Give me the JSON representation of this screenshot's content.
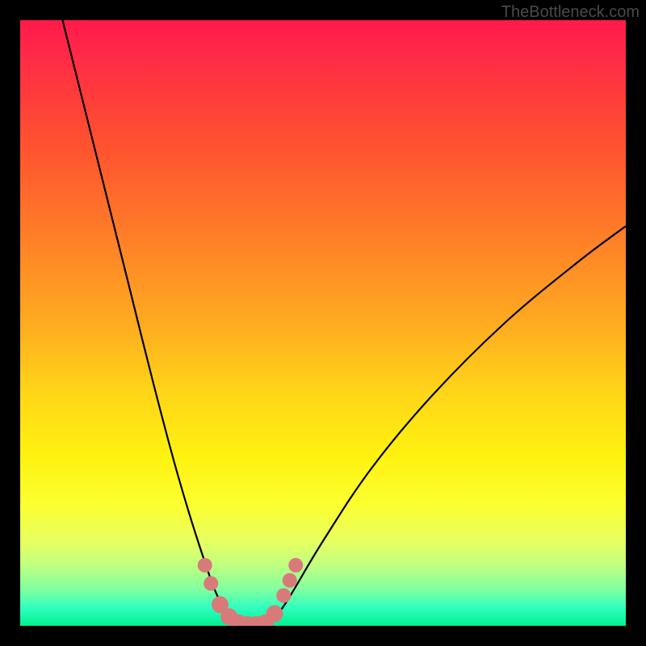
{
  "watermark": "TheBottleneck.com",
  "chart_data": {
    "type": "line",
    "title": "",
    "xlabel": "",
    "ylabel": "",
    "xlim": [
      0,
      100
    ],
    "ylim": [
      0,
      100
    ],
    "background_gradient": {
      "stops": [
        {
          "pos": 0,
          "color": "#ff1a4a"
        },
        {
          "pos": 20,
          "color": "#ff5030"
        },
        {
          "pos": 50,
          "color": "#ffab20"
        },
        {
          "pos": 72,
          "color": "#fff210"
        },
        {
          "pos": 90,
          "color": "#c0ff80"
        },
        {
          "pos": 100,
          "color": "#00f090"
        }
      ]
    },
    "series": [
      {
        "name": "left-curve",
        "color": "#000000",
        "points": [
          {
            "x": 7,
            "y": 100
          },
          {
            "x": 10,
            "y": 88
          },
          {
            "x": 14,
            "y": 72
          },
          {
            "x": 18,
            "y": 56
          },
          {
            "x": 22,
            "y": 40
          },
          {
            "x": 26,
            "y": 25
          },
          {
            "x": 30,
            "y": 12
          },
          {
            "x": 33,
            "y": 4
          },
          {
            "x": 36,
            "y": 0
          }
        ]
      },
      {
        "name": "right-curve",
        "color": "#000000",
        "points": [
          {
            "x": 41,
            "y": 0
          },
          {
            "x": 44,
            "y": 4
          },
          {
            "x": 50,
            "y": 14
          },
          {
            "x": 58,
            "y": 26
          },
          {
            "x": 68,
            "y": 38
          },
          {
            "x": 80,
            "y": 50
          },
          {
            "x": 92,
            "y": 60
          },
          {
            "x": 100,
            "y": 66
          }
        ]
      }
    ],
    "markers": [
      {
        "x": 30.5,
        "y": 10,
        "r": 1.2,
        "color": "#d97a7a"
      },
      {
        "x": 31.5,
        "y": 7,
        "r": 1.2,
        "color": "#d97a7a"
      },
      {
        "x": 33,
        "y": 3.5,
        "r": 1.4,
        "color": "#d97a7a"
      },
      {
        "x": 34.5,
        "y": 1.5,
        "r": 1.4,
        "color": "#d97a7a"
      },
      {
        "x": 36,
        "y": 0.5,
        "r": 1.4,
        "color": "#d97a7a"
      },
      {
        "x": 37.5,
        "y": 0.2,
        "r": 1.4,
        "color": "#d97a7a"
      },
      {
        "x": 39,
        "y": 0.2,
        "r": 1.4,
        "color": "#d97a7a"
      },
      {
        "x": 40.5,
        "y": 0.5,
        "r": 1.4,
        "color": "#d97a7a"
      },
      {
        "x": 42,
        "y": 2,
        "r": 1.4,
        "color": "#d97a7a"
      },
      {
        "x": 43.5,
        "y": 5,
        "r": 1.2,
        "color": "#d97a7a"
      },
      {
        "x": 44.5,
        "y": 7.5,
        "r": 1.2,
        "color": "#d97a7a"
      },
      {
        "x": 45.5,
        "y": 10,
        "r": 1.2,
        "color": "#d97a7a"
      }
    ]
  }
}
